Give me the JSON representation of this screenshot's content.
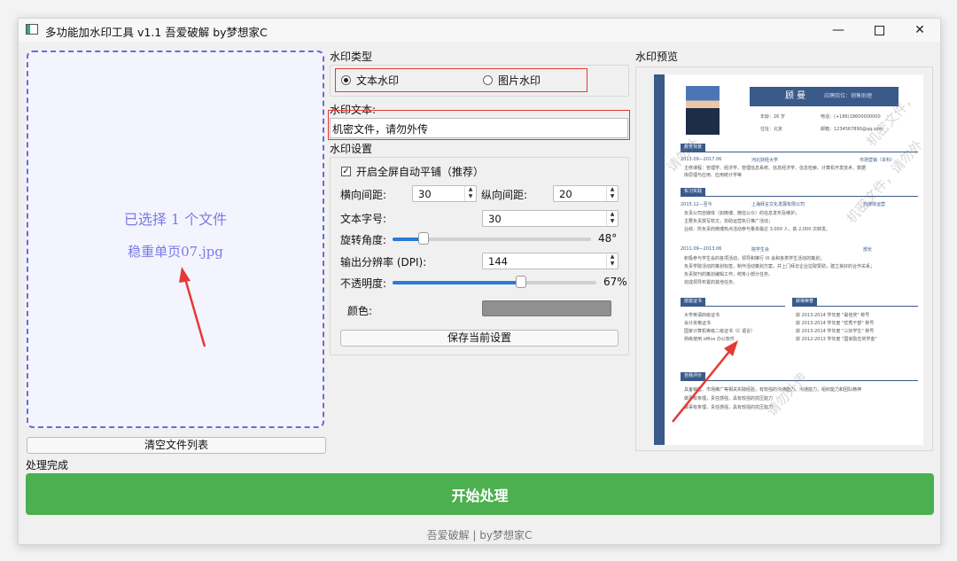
{
  "window": {
    "title": "多功能加水印工具 v1.1 吾爱破解 by梦想家C"
  },
  "left": {
    "selected_count": "已选择 1 个文件",
    "selected_file": "稳重单页07.jpg",
    "clear_button": "清空文件列表",
    "status": "处理完成"
  },
  "mark_type": {
    "label": "水印类型",
    "options": [
      "文本水印",
      "图片水印"
    ],
    "selected": "文本水印"
  },
  "mark_text": {
    "label": "水印文本:",
    "value": "机密文件，请勿外传"
  },
  "settings": {
    "label": "水印设置",
    "tile_label": "开启全屏自动平铺（推荐）",
    "tile_checked": true,
    "h_spacing_label": "横向间距:",
    "h_spacing": "30",
    "v_spacing_label": "纵向间距:",
    "v_spacing": "20",
    "font_size_label": "文本字号:",
    "font_size": "30",
    "rotation_label": "旋转角度:",
    "rotation_value": "48°",
    "rotation_fraction": 0.155,
    "dpi_label": "输出分辨率 (DPI):",
    "dpi": "144",
    "opacity_label": "不透明度:",
    "opacity_value": "67%",
    "opacity_fraction": 0.63,
    "color_label": "颜色:",
    "color": "#909090",
    "save_button": "保存当前设置"
  },
  "preview": {
    "label": "水印预览",
    "resume": {
      "name": "顾 曼",
      "job": "应聘岗位：销售助理",
      "info": [
        "年龄：26 岁",
        "电话：(+186)18600000000",
        "住址：北京",
        "邮箱：1234567890@qq.com"
      ],
      "sections": [
        "教育背景",
        "实习实践",
        "技能证书",
        "获得荣誉",
        "自我评价"
      ],
      "edu_line": [
        "2013.09—2017.06",
        "河北财经大学",
        "市场营销（本科）"
      ],
      "edu_desc": [
        "主修课程：管理学、经济学、管理信息系统、信息经济学、信息检索、计算机开发技术、数据",
        "库原理与应用、应用统计学等"
      ],
      "intern1": [
        "2015.12—至今",
        "上海拜言文化发展有限公司",
        "自媒体运营"
      ],
      "intern1_desc": [
        "负责公司自媒体（如微博、微信公众）的信息发布及维护；",
        "主要负责撰写软文，协助运营执行推广活动；",
        "业绩：所负责的微博热点活动参与量单最达 3,000 人，获 2,000 次转发。"
      ],
      "intern2": [
        "2011.09—2013.06",
        "院学生会",
        "部长"
      ],
      "intern2_desc": [
        "积极参与学生会的各项活动，领导和推行 IX 会和各类学生活动的策划；",
        "负责学院活动的策划标签，制作活动策划方案，并上门拜访企业拉取赞助，建立良好的合作关系；",
        "负责院刊的策划编辑工作，统筹小部分任务。",
        "完成领导布置的其他任务。"
      ],
      "skills": [
        "大学英语四级证书",
        "会计资格证书",
        "国家计算机等级二级证书（C 语言）",
        "熟练使用 office 办公软件"
      ],
      "honors": [
        "获 2013-2014 学年度 \"最佳奖\" 称号",
        "获 2013-2014 学年度 \"优秀干部\" 称号",
        "获 2013-2014 学年度 \"三好学生\" 称号",
        "获 2012-2013 学年度 \"国家励志奖学金\""
      ],
      "self_desc": [
        "具备销售、市场推广等相关实践经验，有较强的沟通能力、沟通能力，组织能力和团队精神",
        "做事有条理，责任感强，具有较强的抗压能力",
        "做事有条理，责任感强，具有较强的抗压能力"
      ],
      "watermarks": [
        "请勿外",
        "机密文件，请勿外",
        "机密文件，",
        "请勿外传"
      ]
    }
  },
  "start_button": "开始处理",
  "footer": "吾爱破解 | by梦想家C"
}
